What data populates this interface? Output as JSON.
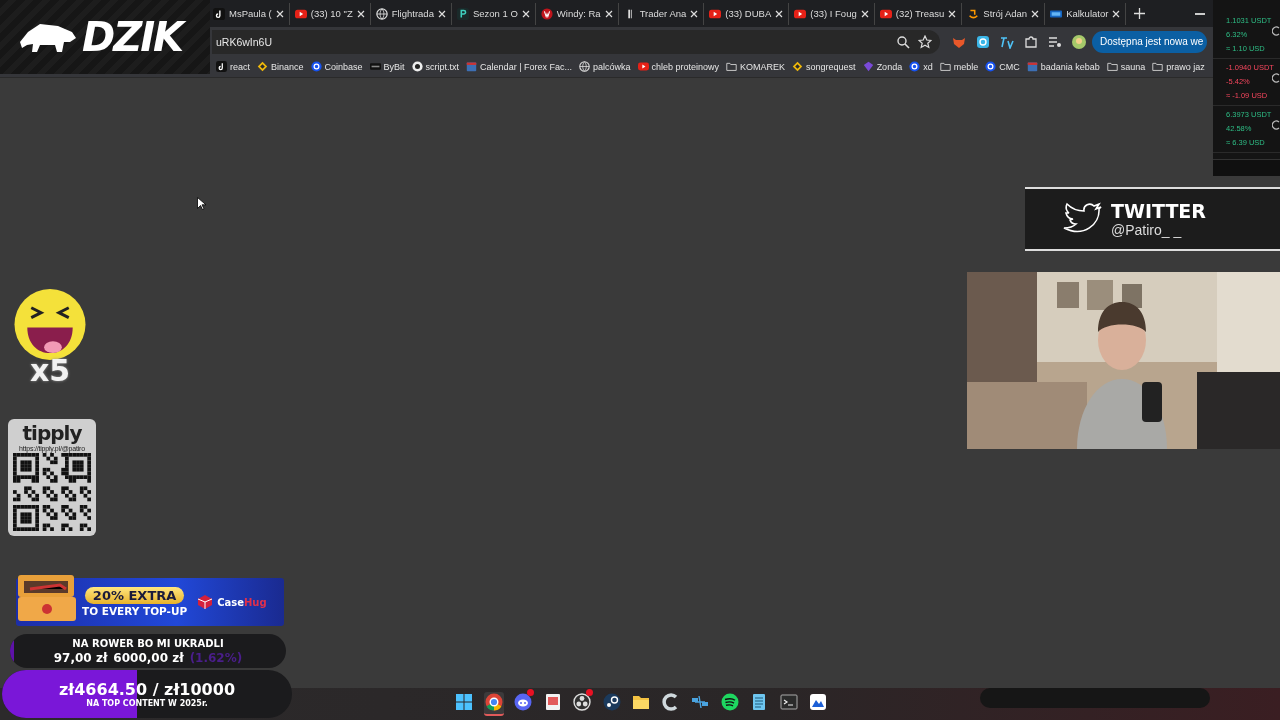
{
  "logo": {
    "text": "DZIK"
  },
  "tabs": [
    {
      "kind": "tiktok",
      "title": "MsPaula ("
    },
    {
      "kind": "youtube",
      "title": "(33) 10 \"Z"
    },
    {
      "kind": "globe",
      "title": "Flightrada"
    },
    {
      "kind": "letter",
      "title": "Sezon 1 O"
    },
    {
      "kind": "windy",
      "title": "Windy: Ra"
    },
    {
      "kind": "bars",
      "title": "Trader Ana"
    },
    {
      "kind": "youtube",
      "title": "(33) DUBA"
    },
    {
      "kind": "youtube",
      "title": "(33) I Foug"
    },
    {
      "kind": "youtube",
      "title": "(32) Treasu"
    },
    {
      "kind": "amazon",
      "title": "Strój Adan"
    },
    {
      "kind": "obm",
      "title": "Kalkulator"
    }
  ],
  "address_bar": {
    "url": "uRK6wIn6U"
  },
  "update_button": {
    "label": "Dostępna jest nowa we"
  },
  "bookmarks": [
    {
      "kind": "tiktok",
      "label": "react"
    },
    {
      "kind": "diamond",
      "label": "Binance"
    },
    {
      "kind": "coin",
      "label": "Coinbase"
    },
    {
      "kind": "dark",
      "label": "ByBit"
    },
    {
      "kind": "github",
      "label": "script.txt"
    },
    {
      "kind": "calendar",
      "label": "Calendar | Forex Fac..."
    },
    {
      "kind": "globe",
      "label": "palcówka"
    },
    {
      "kind": "youtube",
      "label": "chleb proteinowy"
    },
    {
      "kind": "folder",
      "label": "KOMAREK"
    },
    {
      "kind": "diamond",
      "label": "songrequest"
    },
    {
      "kind": "zonda",
      "label": "Zonda"
    },
    {
      "kind": "coin",
      "label": "xd"
    },
    {
      "kind": "folder",
      "label": "meble"
    },
    {
      "kind": "coin",
      "label": "CMC"
    },
    {
      "kind": "calendar",
      "label": "badania kebab"
    },
    {
      "kind": "folder",
      "label": "sauna"
    },
    {
      "kind": "folder",
      "label": "prawo jaz"
    }
  ],
  "pnl": [
    {
      "amount": "1.1031 USDT",
      "percent": "6.32%",
      "usd": "≈ 1.10 USD",
      "kind": "gain"
    },
    {
      "amount": "-1.0940 USDT",
      "percent": "-5.42%",
      "usd": "≈ -1.09 USD",
      "kind": "loss"
    },
    {
      "amount": "6.3973 USDT",
      "percent": "42.58%",
      "usd": "≈ 6.39 USD",
      "kind": "gain"
    }
  ],
  "twitter": {
    "title": "TWITTER",
    "handle": "@Patiro_ _"
  },
  "emote": {
    "count": "x5"
  },
  "tipply": {
    "brand": "tipply",
    "url": "https://tipply.pl/@patiro"
  },
  "promo": {
    "headline": "20% EXTRA",
    "subline": "TO EVERY TOP-UP",
    "brand_a": "Case",
    "brand_b": "Hug"
  },
  "goals": [
    {
      "kind": "small",
      "title": "NA ROWER BO MI UKRADLI",
      "raised": "97,00 zł",
      "target": "6000,00 zł",
      "percent": "(1.62%)",
      "level": 0.0162
    },
    {
      "kind": "large",
      "title": "zł4664.50 / zł10000",
      "subtitle": "NA TOP CONTENT W 2025r.",
      "level": 0.466
    }
  ],
  "taskbar": [
    {
      "kind": "windows",
      "active": false,
      "badge": false
    },
    {
      "kind": "chrome",
      "active": true,
      "badge": false
    },
    {
      "kind": "discord",
      "active": false,
      "badge": true
    },
    {
      "kind": "snip",
      "active": false,
      "badge": false
    },
    {
      "kind": "obs",
      "active": false,
      "badge": true
    },
    {
      "kind": "steam",
      "active": false,
      "badge": false
    },
    {
      "kind": "folder",
      "active": false,
      "badge": false
    },
    {
      "kind": "ccleaner",
      "active": false,
      "badge": false
    },
    {
      "kind": "network",
      "active": false,
      "badge": false
    },
    {
      "kind": "spotify",
      "active": false,
      "badge": false
    },
    {
      "kind": "notepad",
      "active": false,
      "badge": false
    },
    {
      "kind": "terminal",
      "active": false,
      "badge": false
    },
    {
      "kind": "mountain",
      "active": false,
      "badge": false
    }
  ]
}
